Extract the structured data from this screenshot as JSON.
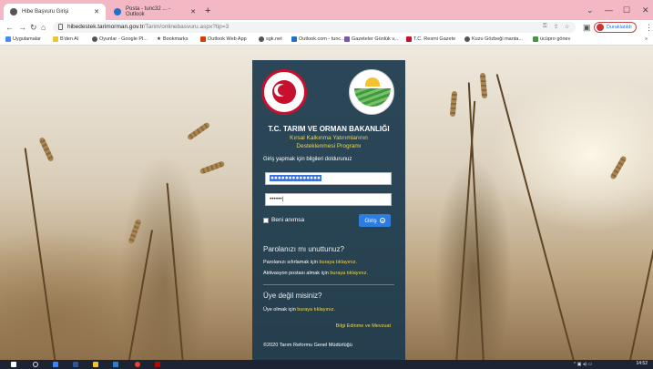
{
  "browser": {
    "tabs": [
      {
        "label": "Hibe Başvuru Girişi",
        "active": true
      },
      {
        "label": "Posta - tunc32 ... - Outlook",
        "active": false
      }
    ],
    "new_tab": "+",
    "window_controls": {
      "minimize": "—",
      "maximize": "☐",
      "close": "✕",
      "chevron": "⌄"
    },
    "url_host": "hibedestek.tarimorman.gov.tr",
    "url_path": "/Tarim/onlinebasvuru.aspx?tip=3",
    "profile_label": "Duraklatıldı",
    "bookmarks": [
      "Uygulamalar",
      "B'den Al",
      "Oyunlar - Google Pl...",
      "Bookmarks",
      "Outlook Web App",
      "sgk.net",
      "Outlook.com - tunc...",
      "Gazeteler Günlük v...",
      "T.C. Resmi Gazete",
      "Kuzu Gözbeği manta...",
      "ücüpro gönev"
    ]
  },
  "panel": {
    "title": "T.C. TARIM VE ORMAN BAKANLIĞI",
    "subtitle_line1": "Kırsal Kalkınma Yatırımlarının",
    "subtitle_line2": "Desteklenmesi Programı",
    "instruction": "Giriş yapmak için bilgileri doldurunuz",
    "username_value": "●●●●●●●●●●●●●●",
    "password_value": "••••••",
    "remember_label": "Beni anımsa",
    "login_button": "Giriş",
    "forgot_heading": "Parolanızı mı unuttunuz?",
    "reset_text": "Parolanızı sıfırlamak için",
    "reset_link": "buraya tıklayınız.",
    "activation_text": "Aktivasyon postası almak için",
    "activation_link": "buraya tıklayınız.",
    "member_heading": "Üye değil misiniz?",
    "member_text": "Üye olmak için",
    "member_link": "buraya tıklayınız.",
    "info_link": "Bilgi Edinme ve Mevzuat",
    "copyright": "©2020 Tarım Reformu Genel Müdürlüğü"
  },
  "taskbar": {
    "time": "14:52"
  },
  "colors": {
    "panel_bg": "#1c3a4e",
    "accent_yellow": "#f0d84a",
    "login_button": "#2d7de0",
    "titlebar": "#f4b8c4"
  }
}
